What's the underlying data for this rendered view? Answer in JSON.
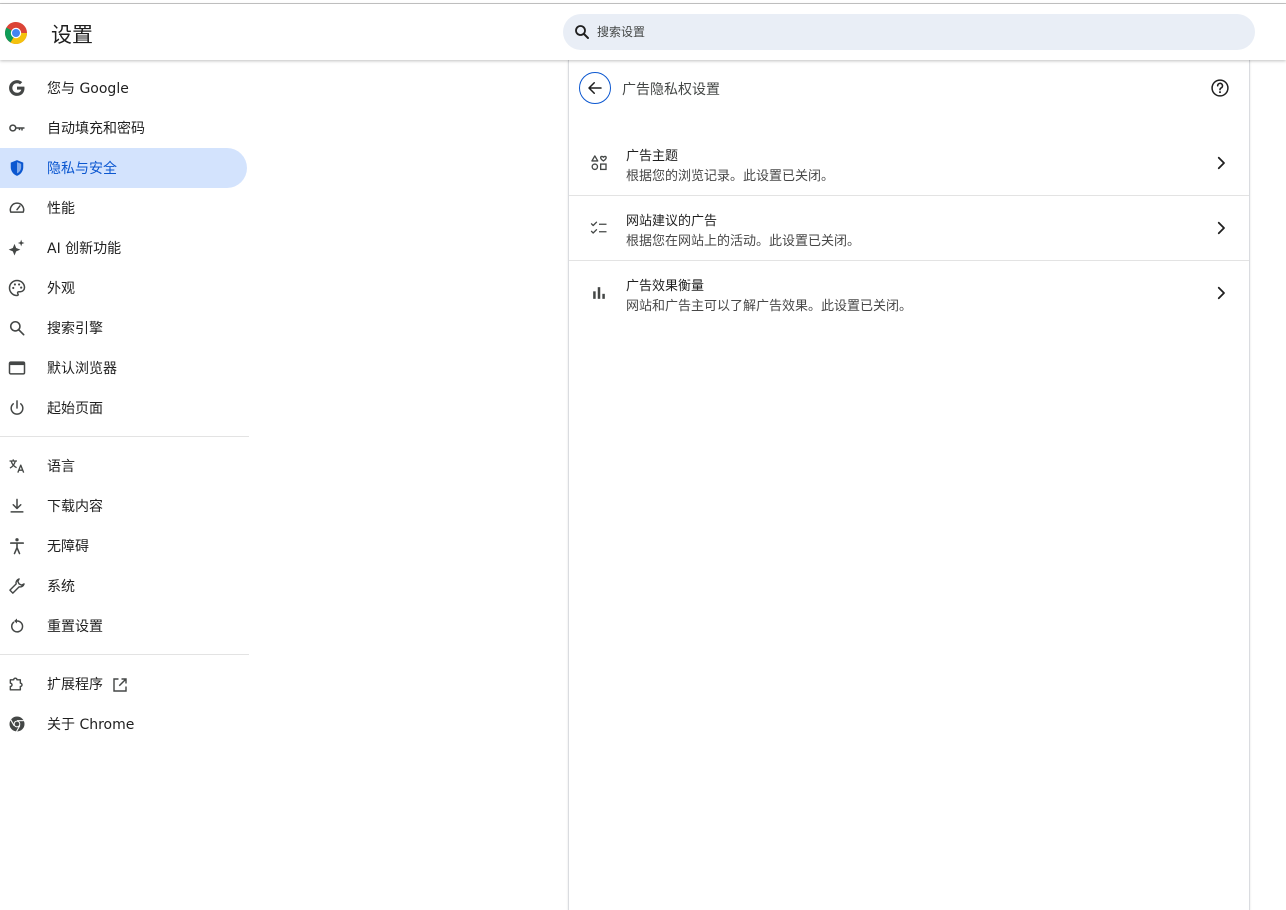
{
  "header": {
    "title": "设置",
    "search_placeholder": "搜索设置"
  },
  "sidebar": {
    "group1": [
      {
        "label": "您与 Google",
        "icon": "google-g-icon"
      },
      {
        "label": "自动填充和密码",
        "icon": "key-icon"
      },
      {
        "label": "隐私与安全",
        "icon": "shield-icon",
        "active": true
      },
      {
        "label": "性能",
        "icon": "speedometer-icon"
      },
      {
        "label": "AI 创新功能",
        "icon": "sparkle-icon"
      },
      {
        "label": "外观",
        "icon": "palette-icon"
      },
      {
        "label": "搜索引擎",
        "icon": "search-icon"
      },
      {
        "label": "默认浏览器",
        "icon": "browser-window-icon"
      },
      {
        "label": "起始页面",
        "icon": "power-icon"
      }
    ],
    "group2": [
      {
        "label": "语言",
        "icon": "translate-icon"
      },
      {
        "label": "下载内容",
        "icon": "download-icon"
      },
      {
        "label": "无障碍",
        "icon": "accessibility-icon"
      },
      {
        "label": "系统",
        "icon": "wrench-icon"
      },
      {
        "label": "重置设置",
        "icon": "reset-icon"
      }
    ],
    "group3": [
      {
        "label": "扩展程序",
        "icon": "puzzle-icon"
      },
      {
        "label": "关于 Chrome",
        "icon": "chrome-icon"
      }
    ]
  },
  "panel": {
    "title": "广告隐私权设置",
    "rows": [
      {
        "title": "广告主题",
        "subtitle": "根据您的浏览记录。此设置已关闭。",
        "icon": "ad-topics-icon"
      },
      {
        "title": "网站建议的广告",
        "subtitle": "根据您在网站上的活动。此设置已关闭。",
        "icon": "checklist-icon"
      },
      {
        "title": "广告效果衡量",
        "subtitle": "网站和广告主可以了解广告效果。此设置已关闭。",
        "icon": "bar-chart-icon"
      }
    ]
  },
  "colors": {
    "accent": "#0b57d0",
    "active_bg": "#d3e3fd",
    "search_bg": "#e9eef6"
  }
}
